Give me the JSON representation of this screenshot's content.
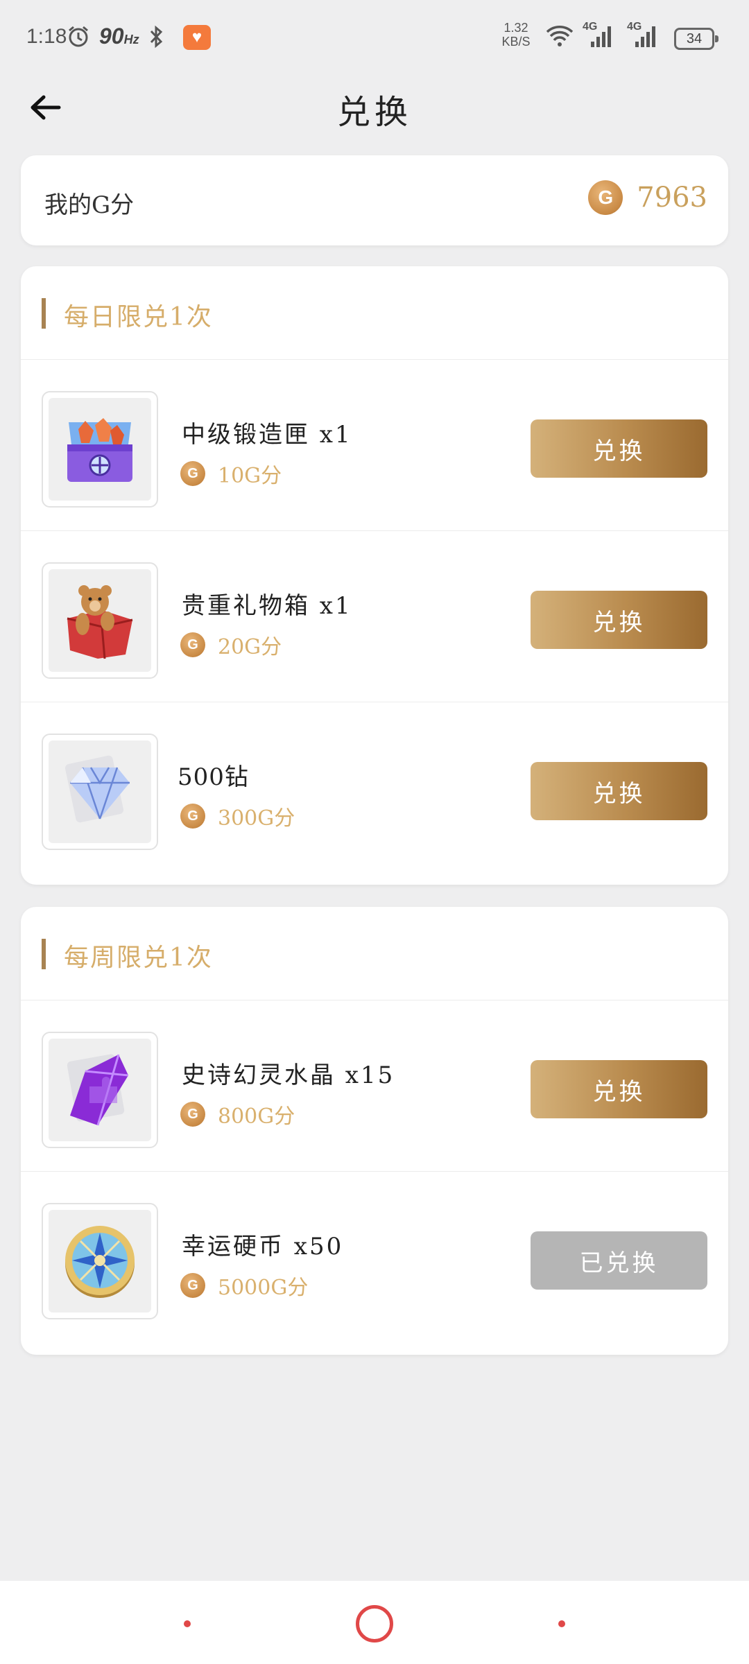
{
  "status": {
    "time": "1:18",
    "refresh_rate": "90",
    "refresh_unit": "Hz",
    "net_speed_value": "1.32",
    "net_speed_unit": "KB/S",
    "signal_1": "4G",
    "signal_2": "4G",
    "battery": "34"
  },
  "header": {
    "title": "兑换"
  },
  "points": {
    "label": "我的G分",
    "coin_glyph": "G",
    "value": "7963"
  },
  "sections": [
    {
      "title": "每日限兑1次",
      "items": [
        {
          "name": "中级锻造匣 x1",
          "cost": "10G分",
          "button": "兑换",
          "redeemed": false,
          "icon": "treasure-chest-icon"
        },
        {
          "name": "贵重礼物箱 x1",
          "cost": "20G分",
          "button": "兑换",
          "redeemed": false,
          "icon": "teddy-bear-gift-box-icon"
        },
        {
          "name": "500钻",
          "cost": "300G分",
          "button": "兑换",
          "redeemed": false,
          "icon": "diamond-icon"
        }
      ]
    },
    {
      "title": "每周限兑1次",
      "items": [
        {
          "name": "史诗幻灵水晶 x15",
          "cost": "800G分",
          "button": "兑换",
          "redeemed": false,
          "icon": "purple-crystal-icon"
        },
        {
          "name": "幸运硬币 x50",
          "cost": "5000G分",
          "button": "已兑换",
          "redeemed": true,
          "icon": "lucky-coin-icon"
        }
      ]
    }
  ],
  "colors": {
    "accent_gold": "#d6ad6a",
    "button_gradient_start": "#d4b17a",
    "button_gradient_end": "#9a6a30",
    "button_disabled": "#b5b5b5",
    "nav_accent": "#e04848"
  }
}
